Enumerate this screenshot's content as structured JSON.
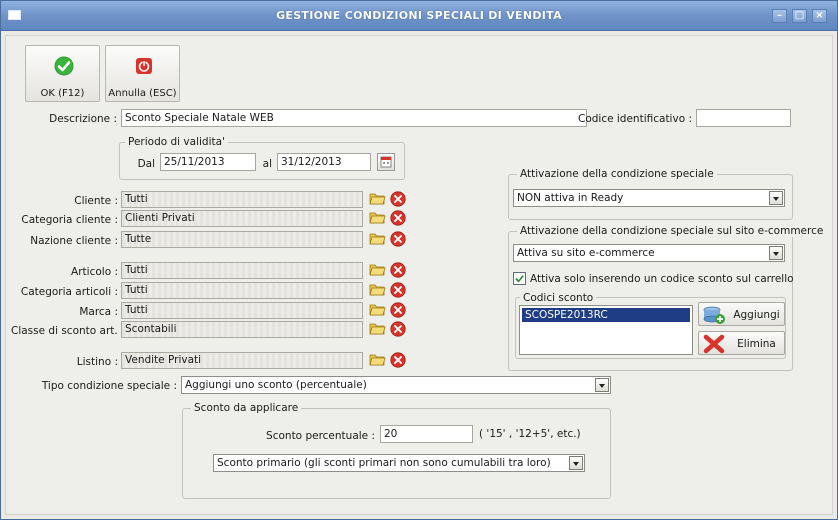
{
  "window": {
    "title": "GESTIONE CONDIZIONI SPECIALI DI VENDITA"
  },
  "toolbar": {
    "ok_label": "OK (F12)",
    "cancel_label": "Annulla (ESC)"
  },
  "form": {
    "descrizione_label": "Descrizione :",
    "descrizione_value": "Sconto Speciale Natale WEB",
    "codice_label": "Codice identificativo :",
    "codice_value": "",
    "periodo_label": "Periodo di validita'",
    "dal_label": "Dal",
    "dal_value": "25/11/2013",
    "al_label": "al",
    "al_value": "31/12/2013",
    "cliente_label": "Cliente :",
    "cliente_value": "Tutti",
    "categoria_cliente_label": "Categoria cliente :",
    "categoria_cliente_value": "Clienti Privati",
    "nazione_label": "Nazione cliente :",
    "nazione_value": "Tutte",
    "articolo_label": "Articolo :",
    "articolo_value": "Tutti",
    "categoria_articoli_label": "Categoria articoli :",
    "categoria_articoli_value": "Tutti",
    "marca_label": "Marca :",
    "marca_value": "Tutti",
    "classe_label": "Classe di sconto art. :",
    "classe_value": "Scontabili",
    "listino_label": "Listino :",
    "listino_value": "Vendite Privati",
    "tipo_label": "Tipo condizione speciale :",
    "tipo_value": "Aggiungi uno sconto (percentuale)",
    "sconto_group_label": "Sconto da applicare",
    "sconto_percentuale_label": "Sconto percentuale :",
    "sconto_percentuale_value": "20",
    "sconto_hint": "( '15' , '12+5', etc.)",
    "sconto_tipo_value": "Sconto primario (gli sconti primari non sono cumulabili tra loro)"
  },
  "activation": {
    "group_label": "Attivazione della condizione speciale",
    "value": "NON attiva in Ready",
    "ecommerce_group_label": "Attivazione della condizione speciale sul sito e-commerce",
    "ecommerce_value": "Attiva su sito e-commerce",
    "checkbox_label": "Attiva solo inserendo un codice sconto sul carrello",
    "checkbox_checked": true,
    "codici_label": "Codici sconto",
    "codici": [
      "SCOSPE2013RC"
    ],
    "aggiungi_label": "Aggiungi",
    "elimina_label": "Elimina"
  },
  "colors": {
    "titlebar": "#6e93c8",
    "selection": "#1f3d84",
    "accent_red": "#d9342b",
    "ok_green": "#2e9e2e"
  }
}
